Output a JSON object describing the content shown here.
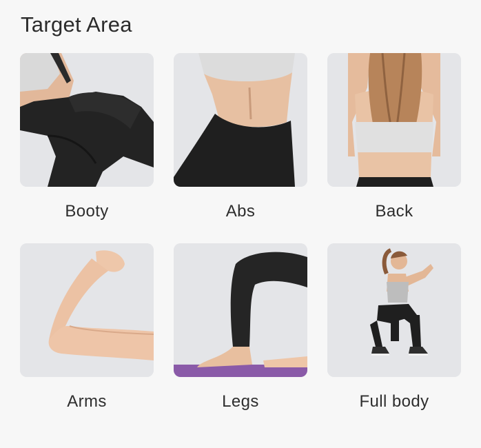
{
  "page": {
    "title": "Target Area"
  },
  "areas": [
    {
      "label": "Booty",
      "icon": "booty-photo"
    },
    {
      "label": "Abs",
      "icon": "abs-photo"
    },
    {
      "label": "Back",
      "icon": "back-photo"
    },
    {
      "label": "Arms",
      "icon": "arms-photo"
    },
    {
      "label": "Legs",
      "icon": "legs-photo"
    },
    {
      "label": "Full body",
      "icon": "full-body-photo"
    }
  ],
  "colors": {
    "background": "#f7f7f7",
    "card": "#e4e5e8",
    "text": "#2b2b2b",
    "legging": "#1f1f1f",
    "skin": "#e9c4a8",
    "top": "#e2e2e2",
    "mat": "#8a5aa8"
  }
}
